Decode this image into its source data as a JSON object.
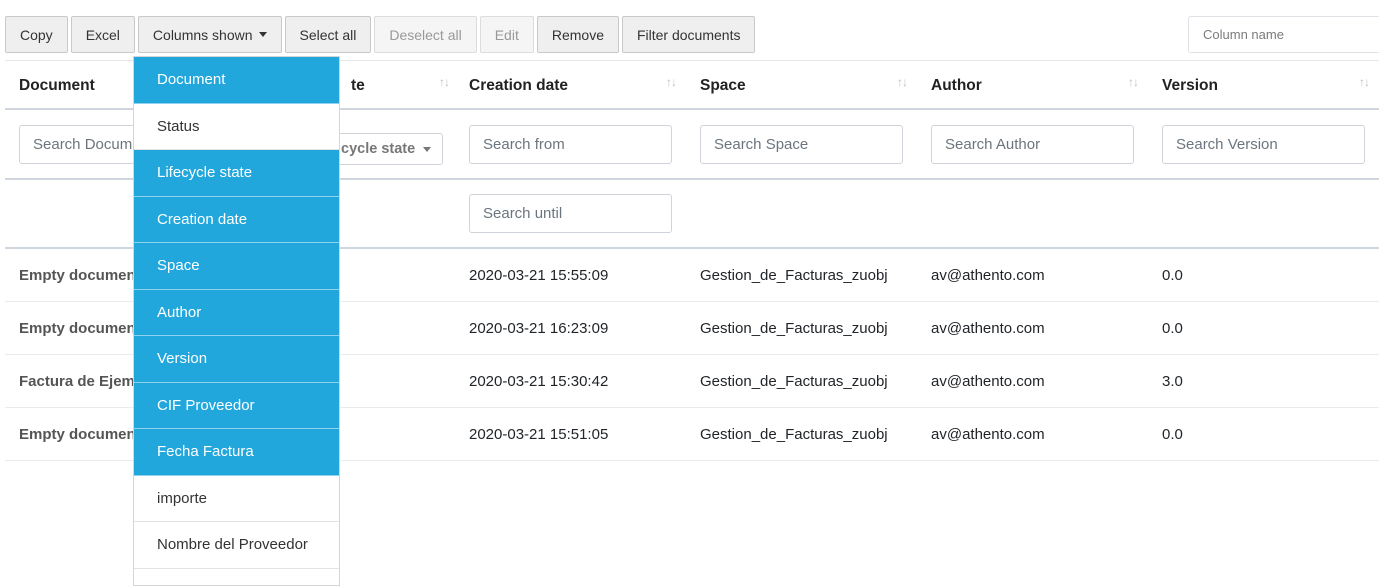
{
  "toolbar": {
    "copy": "Copy",
    "excel": "Excel",
    "columns_shown": "Columns shown",
    "select_all": "Select all",
    "deselect_all": "Deselect all",
    "edit": "Edit",
    "remove": "Remove",
    "filter_documents": "Filter documents"
  },
  "column_search": {
    "placeholder": "Column name"
  },
  "columns": {
    "document": "Document",
    "lifecycle_fragment": "te",
    "creation_date": "Creation date",
    "space": "Space",
    "author": "Author",
    "version": "Version",
    "sort_icon": "↑↓"
  },
  "filters": {
    "document": "Search Document",
    "lifecycle_select_fragment": "cycle state",
    "creation_from": "Search from",
    "creation_until": "Search until",
    "space": "Search Space",
    "author": "Search Author",
    "version": "Search Version"
  },
  "rows": [
    {
      "document": "Empty document",
      "creation_date": "2020-03-21 15:55:09",
      "space": "Gestion_de_Facturas_zuobj",
      "author": "av@athento.com",
      "version": "0.0"
    },
    {
      "document": "Empty document",
      "creation_date": "2020-03-21 16:23:09",
      "space": "Gestion_de_Facturas_zuobj",
      "author": "av@athento.com",
      "version": "0.0"
    },
    {
      "document": "Factura de Ejemplo",
      "creation_date": "2020-03-21 15:30:42",
      "space": "Gestion_de_Facturas_zuobj",
      "author": "av@athento.com",
      "version": "3.0"
    },
    {
      "document": "Empty document",
      "creation_date": "2020-03-21 15:51:05",
      "space": "Gestion_de_Facturas_zuobj",
      "author": "av@athento.com",
      "version": "0.0"
    }
  ],
  "columns_dropdown": [
    {
      "label": "Document",
      "selected": true
    },
    {
      "label": "Status",
      "selected": false
    },
    {
      "label": "Lifecycle state",
      "selected": true
    },
    {
      "label": "Creation date",
      "selected": true
    },
    {
      "label": "Space",
      "selected": true
    },
    {
      "label": "Author",
      "selected": true
    },
    {
      "label": "Version",
      "selected": true
    },
    {
      "label": "CIF Proveedor",
      "selected": true
    },
    {
      "label": "Fecha Factura",
      "selected": true
    },
    {
      "label": "importe",
      "selected": false
    },
    {
      "label": "Nombre del Proveedor",
      "selected": false
    }
  ],
  "colors": {
    "accent": "#22a7dd"
  }
}
